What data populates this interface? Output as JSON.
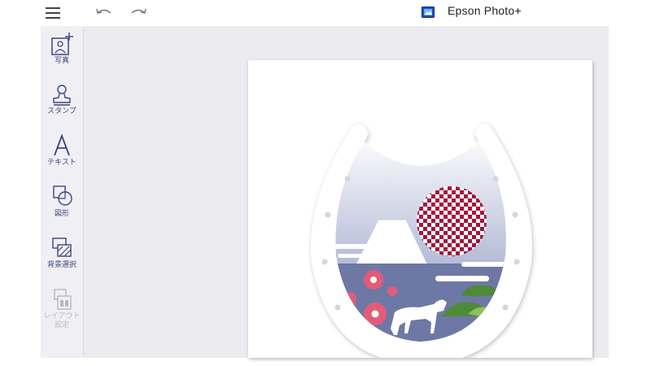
{
  "app": {
    "title": "Epson Photo+"
  },
  "toolbar": {
    "menu_icon": "hamburger-menu-icon",
    "undo_icon": "undo-arrow-icon",
    "redo_icon": "redo-arrow-icon"
  },
  "sidebar": {
    "items": [
      {
        "label": "写真",
        "icon": "add-photo-icon",
        "enabled": true
      },
      {
        "label": "スタンプ",
        "icon": "stamp-icon",
        "enabled": true
      },
      {
        "label": "テキスト",
        "icon": "text-icon",
        "enabled": true
      },
      {
        "label": "図形",
        "icon": "shapes-icon",
        "enabled": true
      },
      {
        "label": "背景選択",
        "icon": "background-icon",
        "enabled": true
      },
      {
        "label": "レイアウト",
        "label2": "設定",
        "icon": "layout-icon",
        "enabled": false
      }
    ]
  },
  "canvas": {
    "artwork": "horseshoe-new-year-card",
    "colors": {
      "accent": "#3a4680",
      "sun": "#a3153a",
      "mountain": "#7580aa",
      "flower": "#e25c7a",
      "pine": "#4f8a3a"
    }
  }
}
